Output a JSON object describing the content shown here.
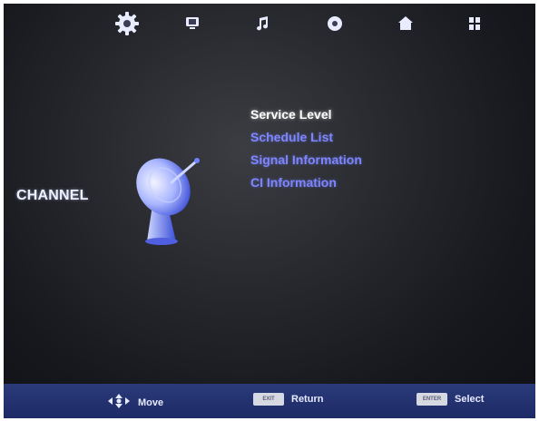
{
  "topbar": {
    "tabs": [
      {
        "name": "settings-gear-icon",
        "active": true
      },
      {
        "name": "monitor-icon",
        "active": false
      },
      {
        "name": "music-note-icon",
        "active": false
      },
      {
        "name": "disc-icon",
        "active": false
      },
      {
        "name": "home-icon",
        "active": false
      },
      {
        "name": "grid-icon",
        "active": false
      }
    ]
  },
  "section": {
    "title": "CHANNEL",
    "icon": "satellite-dish-icon"
  },
  "menu": {
    "items": [
      "Service Level",
      "Schedule List",
      "Signal Information",
      "CI Information"
    ],
    "selected_index": 0
  },
  "footer": {
    "move": {
      "icon": "dpad-arrows-icon",
      "label": "Move"
    },
    "return": {
      "key_label": "EXIT",
      "label": "Return"
    },
    "select": {
      "key_label": "ENTER",
      "label": "Select"
    }
  },
  "colors": {
    "menu_item": "#7e86ff",
    "menu_item_active": "#ffffff",
    "footer_bg": "#22316f"
  }
}
